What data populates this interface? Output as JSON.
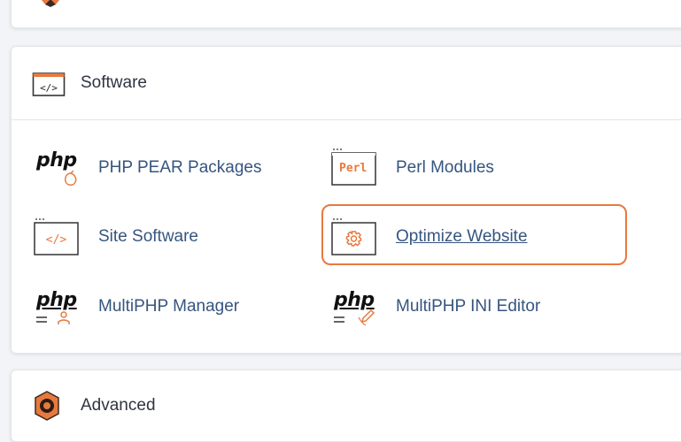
{
  "software": {
    "title": "Software",
    "icon": "code-window-icon",
    "items": [
      {
        "label": "PHP PEAR Packages",
        "icon": "php-pear-icon",
        "icon_text": "php"
      },
      {
        "label": "Perl Modules",
        "icon": "perl-icon",
        "icon_text": "Perl"
      },
      {
        "label": "Site Software",
        "icon": "site-software-icon"
      },
      {
        "label": "Optimize Website",
        "icon": "optimize-gear-icon"
      },
      {
        "label": "MultiPHP Manager",
        "icon": "php-manager-icon",
        "icon_text": "php"
      },
      {
        "label": "MultiPHP INI Editor",
        "icon": "php-ini-editor-icon",
        "icon_text": "php"
      }
    ]
  },
  "advanced": {
    "title": "Advanced",
    "icon": "advanced-gear-icon"
  },
  "colors": {
    "accent": "#e8793e",
    "link": "#35557f",
    "text": "#2f3441"
  }
}
